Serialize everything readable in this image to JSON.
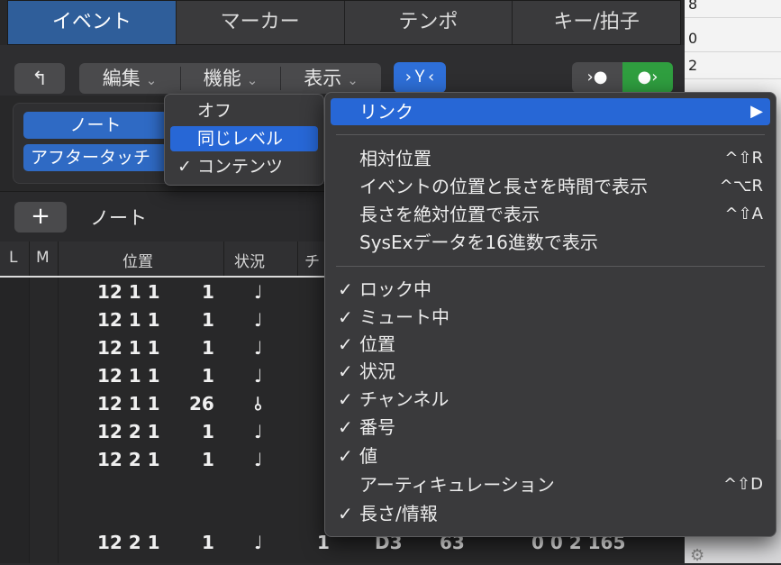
{
  "bg_window": {
    "rows": [
      "8",
      "0",
      "2"
    ]
  },
  "tabs": [
    {
      "label": "イベント",
      "active": true
    },
    {
      "label": "マーカー",
      "active": false
    },
    {
      "label": "テンポ",
      "active": false
    },
    {
      "label": "キー/拍子",
      "active": false
    }
  ],
  "toolbar": {
    "back_icon": "↰",
    "edit_label": "編集",
    "function_label": "機能",
    "view_label": "表示",
    "chevron": "⌄",
    "filter_label": "›Ｙ‹",
    "midi_in": "›●",
    "midi_out": "●›"
  },
  "filter": {
    "note_label": "ノート",
    "aftertouch_label": "アフタータッチ"
  },
  "list": {
    "plus_label": "+",
    "title": "ノート",
    "columns": {
      "l": "L",
      "m": "M",
      "position": "位置",
      "status": "状況",
      "channel": "チ"
    },
    "rows": [
      {
        "pos": "12 1 1",
        "tick": "1",
        "status": "♩"
      },
      {
        "pos": "12 1 1",
        "tick": "1",
        "status": "♩"
      },
      {
        "pos": "12 1 1",
        "tick": "1",
        "status": "♩"
      },
      {
        "pos": "12 1 1",
        "tick": "1",
        "status": "♩"
      },
      {
        "pos": "12 1 1",
        "tick": "26",
        "status": "⫰"
      },
      {
        "pos": "12 2 1",
        "tick": "1",
        "status": "♩"
      },
      {
        "pos": "12 2 1",
        "tick": "1",
        "status": "♩"
      },
      {
        "pos": "12 2 1",
        "tick": "1",
        "status": "♩",
        "ch": "1",
        "num": "D3",
        "val": "63",
        "len": "0 0 2 165"
      }
    ]
  },
  "link_submenu": {
    "items": [
      {
        "label": "オフ",
        "checked": false,
        "highlighted": false
      },
      {
        "label": "同じレベル",
        "checked": false,
        "highlighted": true
      },
      {
        "label": "コンテンツ",
        "checked": true,
        "highlighted": false
      }
    ],
    "check": "✓"
  },
  "view_menu": {
    "link": {
      "label": "リンク",
      "arrow": "▶"
    },
    "options": [
      {
        "label": "相対位置",
        "shortcut": "^⇧R"
      },
      {
        "label": "イベントの位置と長さを時間で表示",
        "shortcut": "^⌥R"
      },
      {
        "label": "長さを絶対位置で表示",
        "shortcut": "^⇧A"
      },
      {
        "label": "SysExデータを16進数で表示",
        "shortcut": ""
      }
    ],
    "columns": [
      {
        "label": "ロック中",
        "checked": true,
        "shortcut": ""
      },
      {
        "label": "ミュート中",
        "checked": true,
        "shortcut": ""
      },
      {
        "label": "位置",
        "checked": true,
        "shortcut": ""
      },
      {
        "label": "状況",
        "checked": true,
        "shortcut": ""
      },
      {
        "label": "チャンネル",
        "checked": true,
        "shortcut": ""
      },
      {
        "label": "番号",
        "checked": true,
        "shortcut": ""
      },
      {
        "label": "値",
        "checked": true,
        "shortcut": ""
      },
      {
        "label": "アーティキュレーション",
        "checked": false,
        "shortcut": "^⇧D"
      },
      {
        "label": "長さ/情報",
        "checked": true,
        "shortcut": ""
      }
    ],
    "check": "✓"
  }
}
